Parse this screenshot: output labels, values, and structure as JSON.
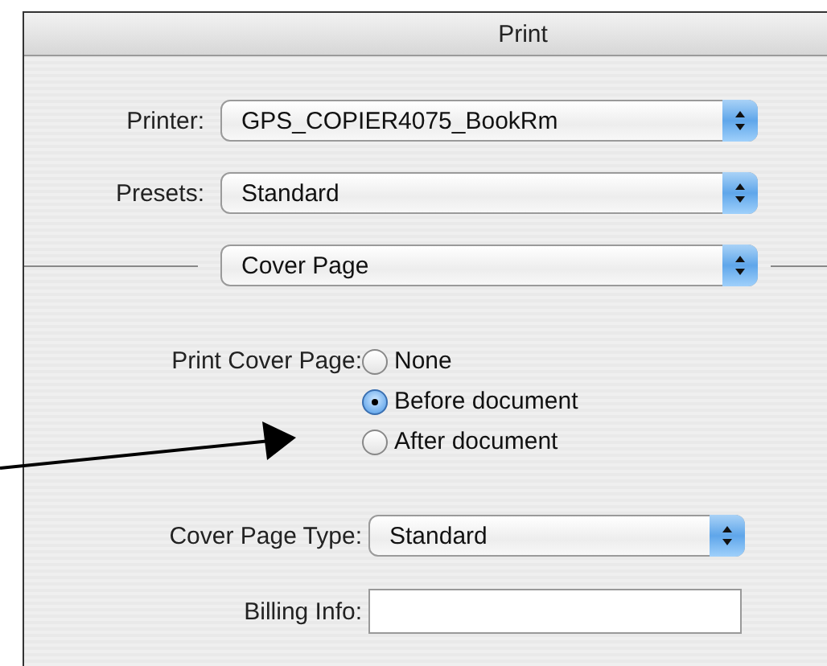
{
  "window": {
    "title": "Print"
  },
  "printer": {
    "label": "Printer:",
    "value": "GPS_COPIER4075_BookRm"
  },
  "presets": {
    "label": "Presets:",
    "value": "Standard"
  },
  "panel_menu": {
    "value": "Cover Page"
  },
  "print_cover_page": {
    "label": "Print Cover Page:",
    "options": [
      {
        "label": "None",
        "selected": false
      },
      {
        "label": "Before document",
        "selected": true
      },
      {
        "label": "After document",
        "selected": false
      }
    ]
  },
  "cover_page_type": {
    "label": "Cover Page Type:",
    "value": "Standard"
  },
  "billing_info": {
    "label": "Billing Info:"
  }
}
